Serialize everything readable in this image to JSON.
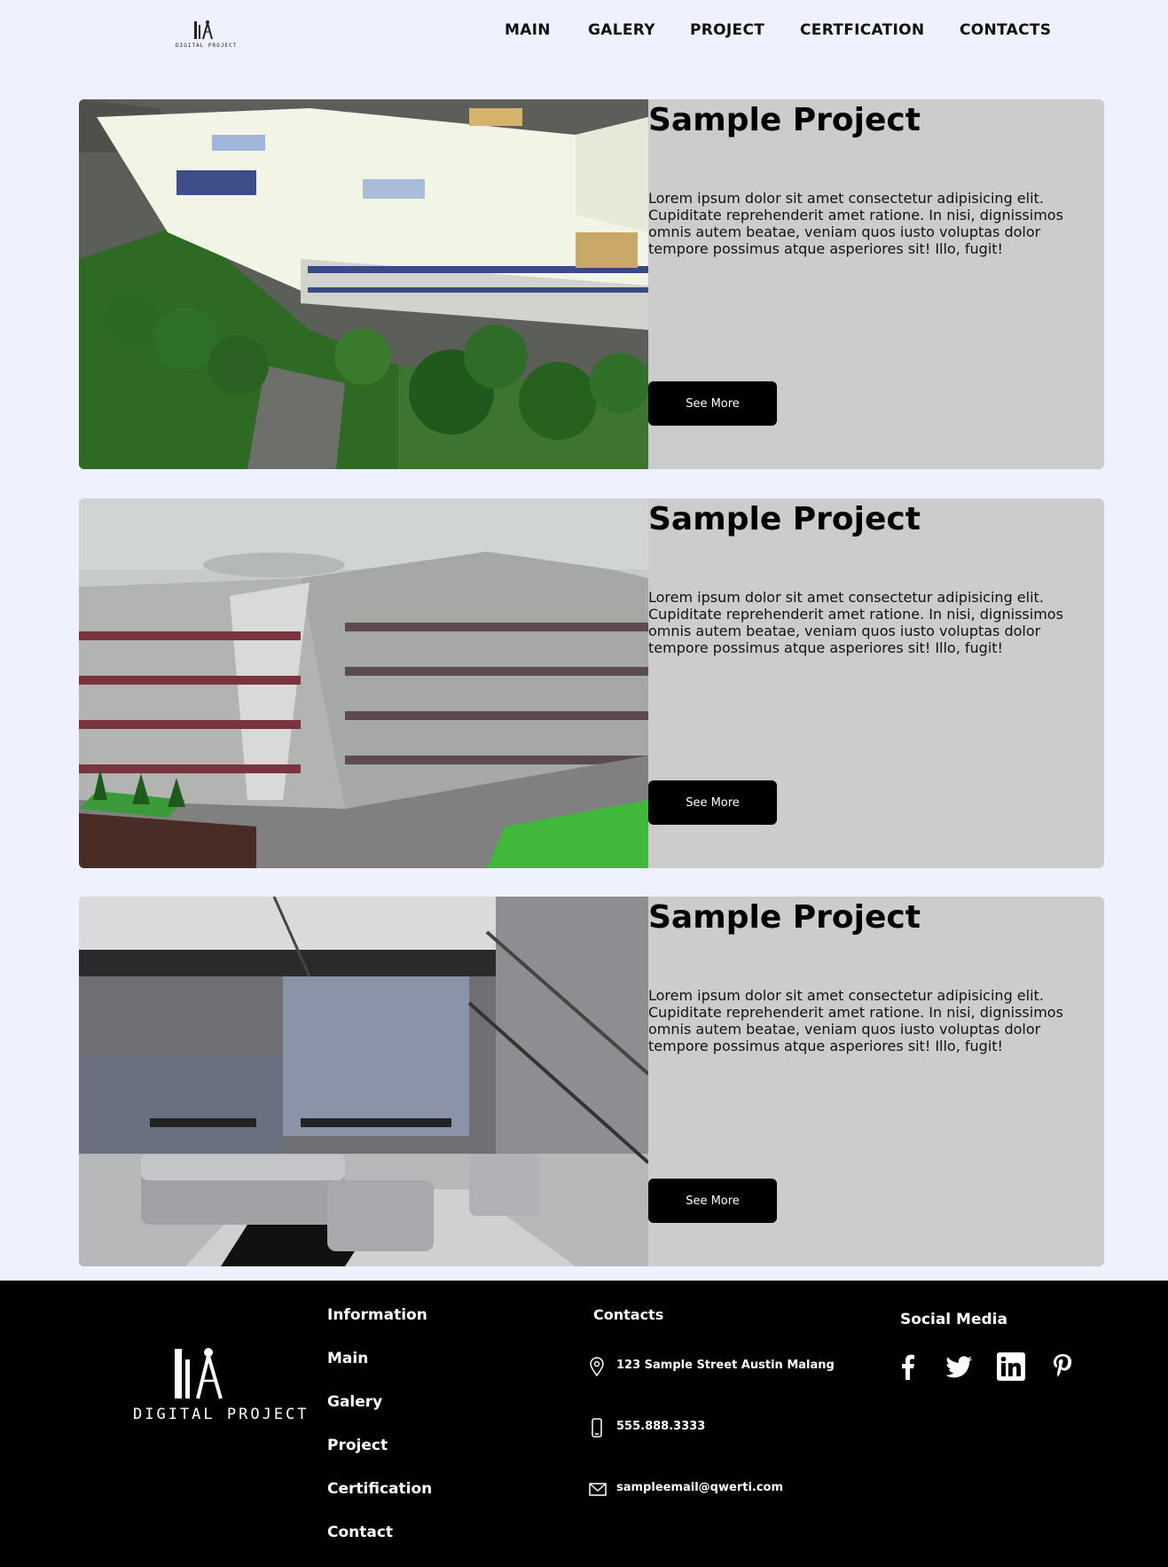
{
  "header": {
    "logo_text": "DIGITAL PROJECT",
    "nav": [
      {
        "label": "MAIN"
      },
      {
        "label": "GALERY"
      },
      {
        "label": "PROJECT"
      },
      {
        "label": "CERTFICATION"
      },
      {
        "label": "CONTACTS"
      }
    ]
  },
  "projects": [
    {
      "title": "Sample Project",
      "description": "Lorem ipsum dolor sit amet consectetur adipisicing elit. Cupiditate reprehenderit amet ratione. In nisi, dignissimos omnis autem beatae, veniam quos iusto voluptas dolor tempore possimus atque asperiores sit! Illo, fugit!",
      "button_label": "See More"
    },
    {
      "title": "Sample Project",
      "description": "Lorem ipsum dolor sit amet consectetur adipisicing elit. Cupiditate reprehenderit amet ratione. In nisi, dignissimos omnis autem beatae, veniam quos iusto voluptas dolor tempore possimus atque asperiores sit! Illo, fugit!",
      "button_label": "See More"
    },
    {
      "title": "Sample Project",
      "description": "Lorem ipsum dolor sit amet consectetur adipisicing elit. Cupiditate reprehenderit amet ratione. In nisi, dignissimos omnis autem beatae, veniam quos iusto voluptas dolor tempore possimus atque asperiores sit! Illo, fugit!",
      "button_label": "See More"
    }
  ],
  "footer": {
    "logo_text": "DIGITAL PROJECT",
    "information": {
      "title": "Information",
      "links": [
        "Main",
        "Galery",
        "Project",
        "Certification",
        "Contact"
      ]
    },
    "contacts": {
      "title": "Contacts",
      "address": "123 Sample Street Austin Malang",
      "phone": "555.888.3333",
      "email": "sampleemail@qwerti.com"
    },
    "social": {
      "title": "Social Media",
      "icons": [
        "facebook-icon",
        "twitter-icon",
        "linkedin-icon",
        "pinterest-icon"
      ]
    }
  },
  "colors": {
    "page_background": "#eff1fe",
    "card_background": "#cccccc",
    "button_background": "#000000",
    "footer_background": "#000000"
  }
}
